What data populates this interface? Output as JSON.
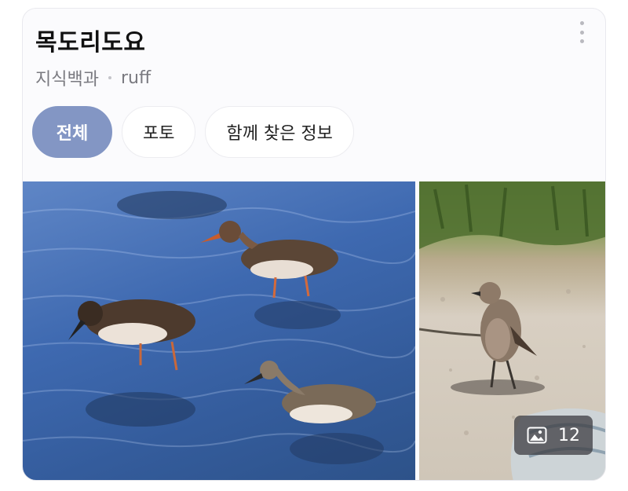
{
  "header": {
    "title": "목도리도요",
    "source_name": "지식백과",
    "source_term": "ruff"
  },
  "tabs": [
    {
      "label": "전체",
      "active": true
    },
    {
      "label": "포토",
      "active": false
    },
    {
      "label": "함께 찾은 정보",
      "active": false
    }
  ],
  "gallery": {
    "photo_count": "12",
    "main_photo": "ruff-birds-wading-in-water",
    "side_photo": "bird-standing-on-gravel-shore"
  },
  "colors": {
    "active_tab": "#8396c4",
    "water": "#3e69b0",
    "shore": "#d8cfc2"
  }
}
